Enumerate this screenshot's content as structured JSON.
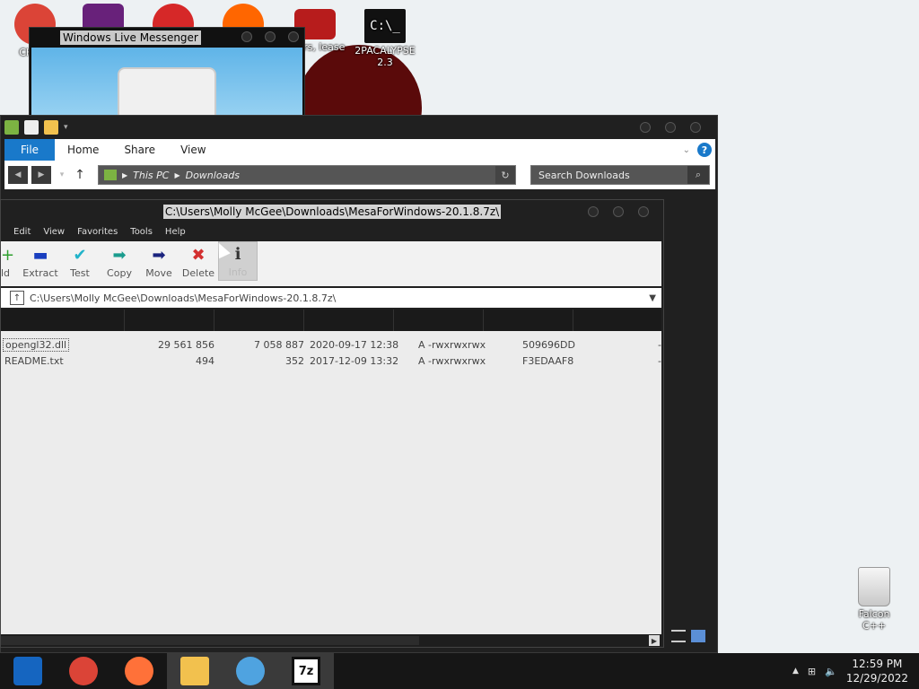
{
  "desktop": {
    "icons": [
      {
        "label": "CHR D",
        "color": "#db4437"
      },
      {
        "label": "",
        "color": "#68217a"
      },
      {
        "label": "",
        "color": "#d62828"
      },
      {
        "label": "",
        "color": "#ff6600"
      },
      {
        "label": "apers, lease",
        "color": "#b71c1c"
      },
      {
        "label": "2PACALYPSE 2.3",
        "color": "#111111"
      }
    ],
    "recycle_bin": {
      "label": "Falcon C++"
    }
  },
  "messenger": {
    "title": "Windows Live Messenger"
  },
  "explorer": {
    "tabs": [
      "File",
      "Home",
      "Share",
      "View"
    ],
    "help": "?",
    "breadcrumb": [
      "This PC",
      "Downloads"
    ],
    "search_placeholder": "Search Downloads"
  },
  "sevenzip": {
    "title": "C:\\Users\\Molly McGee\\Downloads\\MesaForWindows-20.1.8.7z\\",
    "menu": [
      "Edit",
      "View",
      "Favorites",
      "Tools",
      "Help"
    ],
    "toolbar": [
      {
        "label": "ld",
        "icon": "+",
        "color": "#2ea02e"
      },
      {
        "label": "Extract",
        "icon": "▬",
        "color": "#1a3fbf"
      },
      {
        "label": "Test",
        "icon": "✔",
        "color": "#21b3c9"
      },
      {
        "label": "Copy",
        "icon": "➡",
        "color": "#1b9c8e"
      },
      {
        "label": "Move",
        "icon": "➡",
        "color": "#1a237e"
      },
      {
        "label": "Delete",
        "icon": "✖",
        "color": "#d32f2f"
      },
      {
        "label": "Info",
        "icon": "ℹ",
        "color": "#333333"
      }
    ],
    "path": "C:\\Users\\Molly McGee\\Downloads\\MesaForWindows-20.1.8.7z\\",
    "files": [
      {
        "name": "opengl32.dll",
        "size": "29 561 856",
        "packed": "7 058 887",
        "modified": "2020-09-17 12:38",
        "attributes": "A -rwxrwxrwx",
        "crc": "509696DD",
        "encrypted": "-"
      },
      {
        "name": "README.txt",
        "size": "494",
        "packed": "352",
        "modified": "2017-12-09 13:32",
        "attributes": "A -rwxrwxrwx",
        "crc": "F3EDAAF8",
        "encrypted": "-"
      }
    ]
  },
  "taskbar": {
    "apps": [
      {
        "name": "chrome-canary",
        "color": "#1565c0"
      },
      {
        "name": "chrome",
        "color": "#db4437"
      },
      {
        "name": "firefox",
        "color": "#ff7139"
      },
      {
        "name": "file-explorer",
        "color": "#f2c14e"
      },
      {
        "name": "messenger",
        "color": "#4fa3e0"
      },
      {
        "name": "7zip",
        "color": "#111111"
      }
    ],
    "time": "12:59 PM",
    "date": "12/29/2022"
  }
}
